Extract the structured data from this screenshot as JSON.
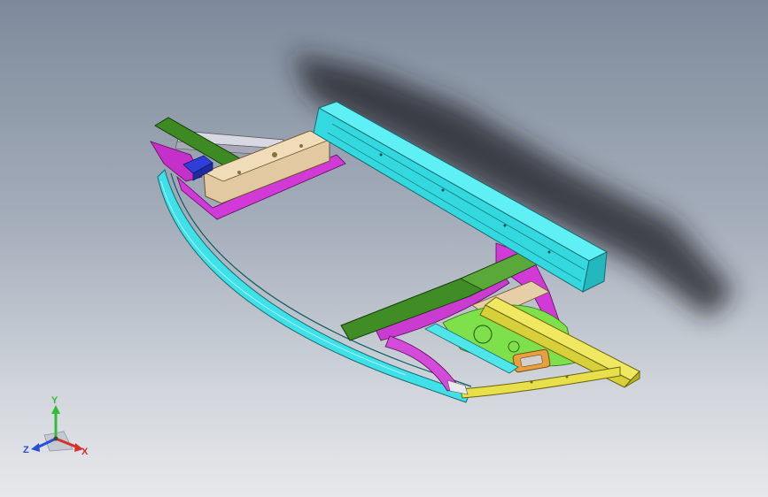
{
  "view": {
    "background_top": "#7e8a9b",
    "background_bottom": "#e6e8eb"
  },
  "parts": {
    "cyan_cross_beam": "#33e0e6",
    "tan_rail": "#e0c8a0",
    "green_members": "#3d8a22",
    "magenta_members": "#d13ad6",
    "yellow_rail": "#e8e04a",
    "blue_bracket": "#2e3fd8",
    "light_green_panel": "#7ee04a",
    "orange_part": "#e6a040",
    "grey_strut": "#c8c8d4",
    "shadow": "#1c1f24"
  },
  "triad": {
    "y_label": "Y",
    "z_label": "Z",
    "x_label": "X",
    "y_color": "#2dbf3a",
    "z_color": "#2a4fd8",
    "x_color": "#d8302a"
  }
}
